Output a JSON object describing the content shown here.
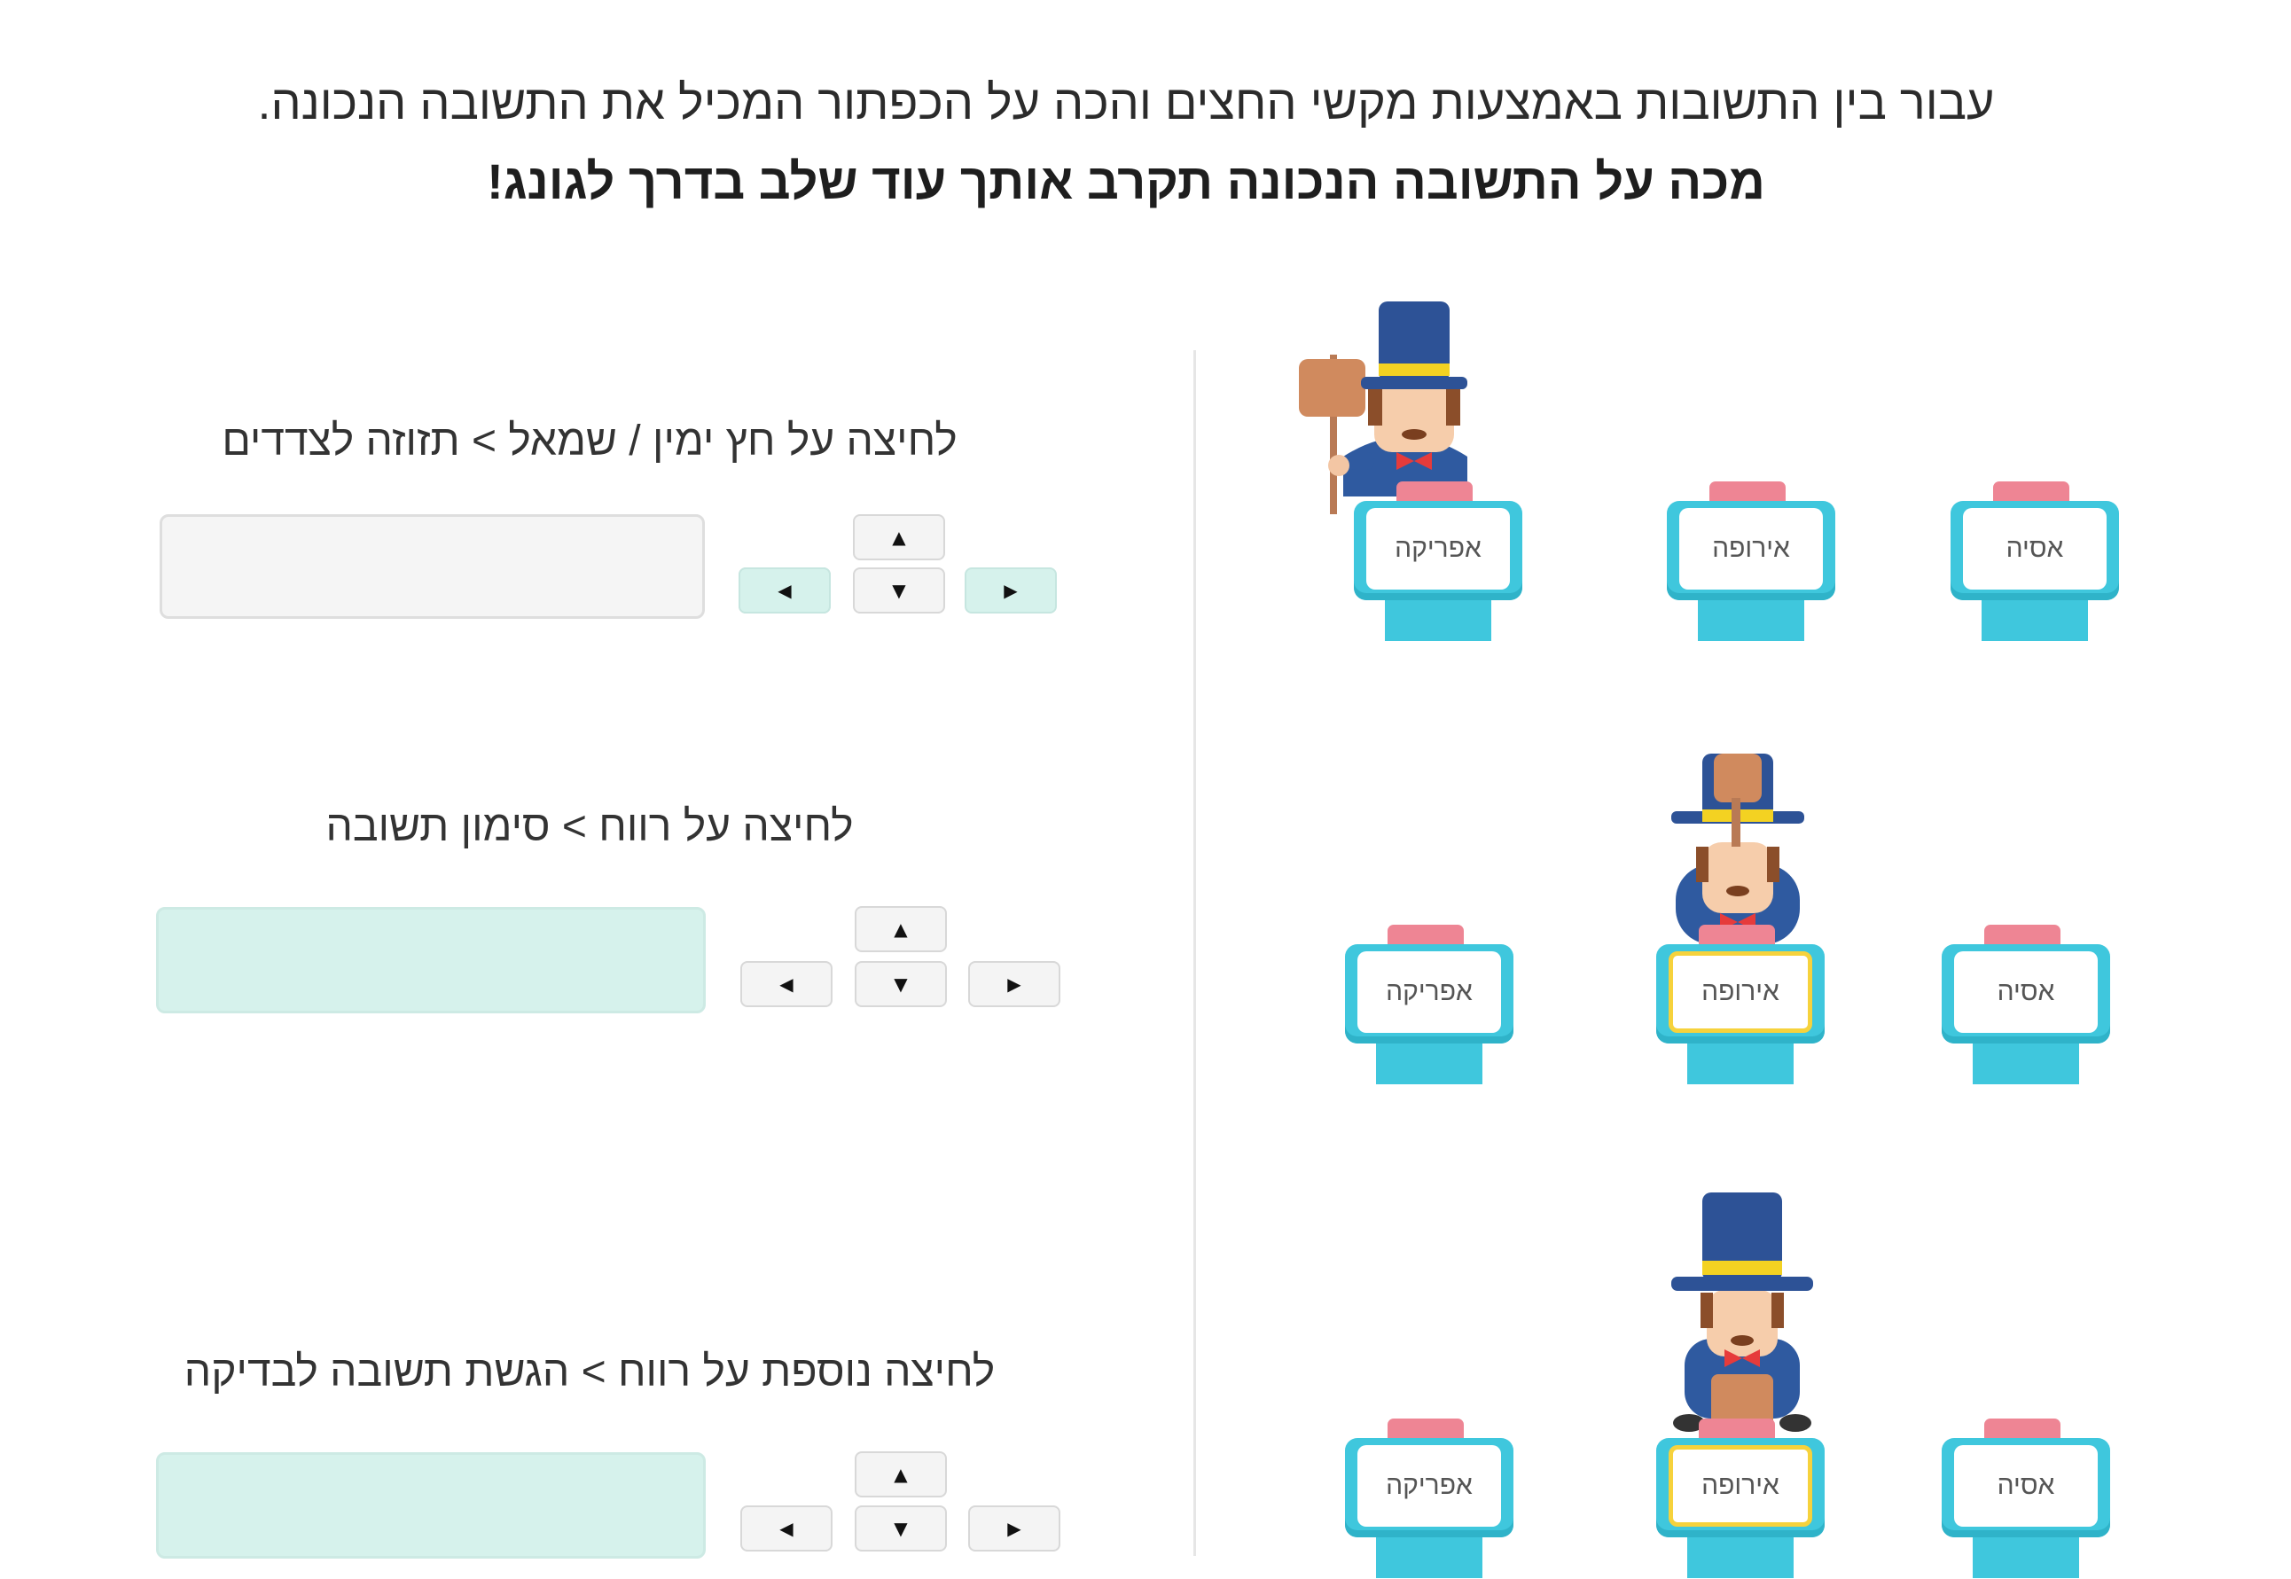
{
  "header": {
    "line1": "עבור בין התשובות באמצעות מקשי החצים והכה על הכפתור המכיל את התשובה הנכונה.",
    "line2": "מכה על התשובה הנכונה תקרב אותך עוד שלב בדרך לגונג!"
  },
  "instructions": [
    "לחיצה על חץ ימין / שמאל > תזוזה לצדדים",
    "לחיצה על רווח > סימון תשובה",
    "לחיצה נוספת על רווח > הגשת תשובה לבדיקה"
  ],
  "keys": {
    "up": "▲",
    "down": "▼",
    "left": "◀",
    "right": "▶"
  },
  "answers": [
    "אפריקה",
    "אירופה",
    "אסיה"
  ],
  "colors": {
    "podium": "#3fc7dd",
    "button": "#ee8594",
    "selected": "#f6d23c",
    "highlight": "#d6f2ec"
  },
  "icons": [
    "auctioneer-character-icon",
    "gavel-icon"
  ]
}
